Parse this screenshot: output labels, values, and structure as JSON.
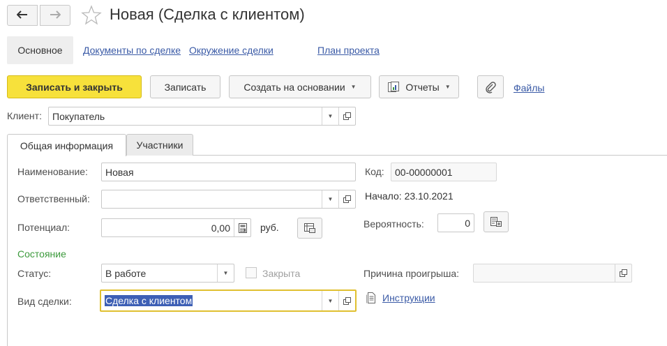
{
  "window": {
    "title": "Новая (Сделка с клиентом)",
    "nav": {
      "back_icon": "arrow-left-icon",
      "forward_icon": "arrow-right-icon",
      "favorite_icon": "star-icon"
    }
  },
  "section_tabs": {
    "active": "Основное",
    "links": [
      "Документы по сделке",
      "Окружение сделки",
      "План проекта"
    ]
  },
  "toolbar": {
    "save_close": "Записать и закрыть",
    "save": "Записать",
    "create_based": "Создать на основании",
    "reports": "Отчеты",
    "attach_icon": "paperclip-icon",
    "files": "Файлы"
  },
  "client": {
    "label": "Клиент:",
    "value": "Покупатель"
  },
  "tabs": [
    "Общая информация",
    "Участники"
  ],
  "general": {
    "name_label": "Наименование:",
    "name_value": "Новая",
    "code_label": "Код:",
    "code_value": "00-00000001",
    "responsible_label": "Ответственный:",
    "responsible_value": "",
    "start_label": "Начало:",
    "start_value": "23.10.2021",
    "potential_label": "Потенциал:",
    "potential_value": "0,00",
    "currency": "руб.",
    "probability_label": "Вероятность:",
    "probability_value": "0"
  },
  "state": {
    "title": "Состояние",
    "status_label": "Статус:",
    "status_value": "В работе",
    "closed_label": "Закрыта",
    "closed_checked": false,
    "loss_reason_label": "Причина проигрыша:",
    "loss_reason_value": "",
    "deal_type_label": "Вид сделки:",
    "deal_type_value": "Сделка с клиентом",
    "instructions": "Инструкции"
  },
  "colors": {
    "primary_button": "#f7e13b",
    "link": "#3a5aa6",
    "section_title": "#3c9a3c",
    "focus_border": "#e0c030",
    "selection": "#3d5fb5"
  }
}
